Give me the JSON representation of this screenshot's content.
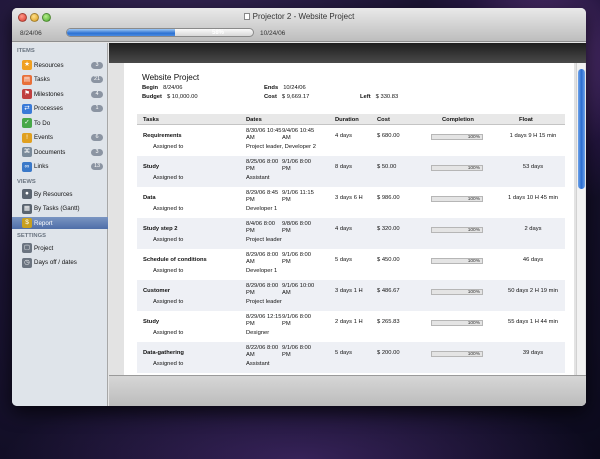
{
  "window": {
    "title": "Projector 2 - Website Project",
    "start_date": "8/24/06",
    "end_date": "10/24/06",
    "progress_label": "58%",
    "progress_fraction": 0.58
  },
  "sidebar": {
    "items_header": "ITEMS",
    "items": [
      {
        "label": "Resources",
        "count": "3",
        "icon": "star-icon",
        "color": "#f0a020",
        "glyph": "★"
      },
      {
        "label": "Tasks",
        "count": "21",
        "icon": "tasks-icon",
        "color": "#e8703a",
        "glyph": "▤"
      },
      {
        "label": "Milestones",
        "count": "4",
        "icon": "milestone-icon",
        "color": "#c04040",
        "glyph": "⚑"
      },
      {
        "label": "Processes",
        "count": "1",
        "icon": "process-icon",
        "color": "#3a7ad8",
        "glyph": "⇄"
      },
      {
        "label": "To Do",
        "count": "",
        "icon": "todo-icon",
        "color": "#48a848",
        "glyph": "✓"
      },
      {
        "label": "Events",
        "count": "6",
        "icon": "event-icon",
        "color": "#e0a020",
        "glyph": "!"
      },
      {
        "label": "Documents",
        "count": "3",
        "icon": "paperclip-icon",
        "color": "#7a8a9a",
        "glyph": "⌘"
      },
      {
        "label": "Links",
        "count": "13",
        "icon": "link-icon",
        "color": "#3a78c8",
        "glyph": "∞"
      }
    ],
    "views_header": "VIEWS",
    "views": [
      {
        "label": "By Resources",
        "icon": "person-icon",
        "glyph": "●"
      },
      {
        "label": "By Tasks (Gantt)",
        "icon": "gantt-icon",
        "glyph": "▦"
      },
      {
        "label": "Report",
        "icon": "dollar-icon",
        "glyph": "$"
      }
    ],
    "settings_header": "SETTINGS",
    "settings": [
      {
        "label": "Project",
        "icon": "project-icon",
        "glyph": "▢"
      },
      {
        "label": "Days off / dates",
        "icon": "clock-icon",
        "glyph": "◷"
      }
    ]
  },
  "report": {
    "title": "Website Project",
    "begin_label": "Begin",
    "begin": "8/24/06",
    "ends_label": "Ends",
    "ends": "10/24/06",
    "budget_label": "Budget",
    "budget": "$ 10,000.00",
    "cost_label": "Cost",
    "cost": "$ 9,669.17",
    "left_label": "Left",
    "left": "$ 330.83",
    "columns": [
      "Tasks",
      "Dates",
      "Duration",
      "Cost",
      "Completion",
      "Float"
    ],
    "rows": [
      {
        "task": "Requirements",
        "assigned": "Assigned to",
        "start_a": "8/30/06 10:45 AM",
        "start_b": "AM",
        "end_a": "9/4/06 10:45",
        "end_b": "AM",
        "start_top": "8/30/06 10:45",
        "people": "Project leader, Developer 2",
        "duration": "4 days",
        "cost": "$ 680.00",
        "completion": "100%",
        "completion_fraction": 1.0,
        "float": "1 days 9 H 15 min"
      },
      {
        "task": "Study",
        "assigned": "Assigned to",
        "start_top": "8/25/06 8:00",
        "start_b": "PM",
        "end_a": "9/1/06 8:00",
        "end_b": "PM",
        "people": "Assistant",
        "duration": "8 days",
        "cost": "$ 50.00",
        "completion": "100%",
        "completion_fraction": 1.0,
        "float": "53 days"
      },
      {
        "task": "Data",
        "assigned": "Assigned to",
        "start_top": "8/29/06 8:45",
        "start_b": "PM",
        "end_a": "9/1/06 11:15",
        "end_b": "PM",
        "people": "Developer 1",
        "duration": "3 days 6 H",
        "cost": "$ 986.00",
        "completion": "100%",
        "completion_fraction": 1.0,
        "float": "1 days 10 H 45 min"
      },
      {
        "task": "Study step 2",
        "assigned": "Assigned to",
        "start_top": "8/4/06 8:00",
        "start_b": "PM",
        "end_a": "9/8/06 8:00",
        "end_b": "PM",
        "people": "Project leader",
        "duration": "4 days",
        "cost": "$ 320.00",
        "completion": "100%",
        "completion_fraction": 1.0,
        "float": "2 days"
      },
      {
        "task": "Schedule of conditions",
        "assigned": "Assigned to",
        "start_top": "8/29/06 8:00",
        "start_b": "AM",
        "end_a": "9/1/06 8:00",
        "end_b": "PM",
        "people": "Developer 1",
        "duration": "5 days",
        "cost": "$ 450.00",
        "completion": "100%",
        "completion_fraction": 1.0,
        "float": "46 days"
      },
      {
        "task": "Customer",
        "assigned": "Assigned to",
        "start_top": "8/29/06 8:00",
        "start_b": "PM",
        "end_a": "9/1/06 10:00",
        "end_b": "AM",
        "people": "Project leader",
        "duration": "3 days 1 H",
        "cost": "$ 486.67",
        "completion": "100%",
        "completion_fraction": 1.0,
        "float": "50 days 2 H 19 min"
      },
      {
        "task": "Study",
        "assigned": "Assigned to",
        "start_top": "8/29/06 12:15",
        "start_b": "PM",
        "end_a": "9/1/06 8:00",
        "end_b": "PM",
        "people": "Designer",
        "duration": "2 days 1 H",
        "cost": "$ 265.83",
        "completion": "100%",
        "completion_fraction": 1.0,
        "float": "55 days 1 H 44 min"
      },
      {
        "task": "Data-gathering",
        "assigned": "Assigned to",
        "start_top": "8/22/06 8:00",
        "start_b": "AM",
        "end_a": "9/1/06 8:00",
        "end_b": "PM",
        "people": "Assistant",
        "duration": "5 days",
        "cost": "$ 200.00",
        "completion": "100%",
        "completion_fraction": 1.0,
        "float": "39 days"
      }
    ]
  }
}
